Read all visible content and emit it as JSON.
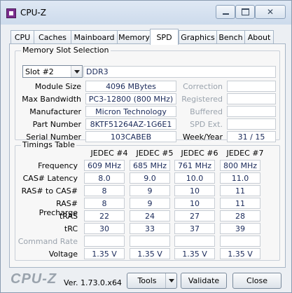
{
  "window": {
    "title": "CPU-Z"
  },
  "tabs": [
    "CPU",
    "Caches",
    "Mainboard",
    "Memory",
    "SPD",
    "Graphics",
    "Bench",
    "About"
  ],
  "active_tab": "SPD",
  "memory_slot": {
    "group_title": "Memory Slot Selection",
    "slot": "Slot #2",
    "type": "DDR3",
    "labels": {
      "module_size": "Module Size",
      "max_bandwidth": "Max Bandwidth",
      "manufacturer": "Manufacturer",
      "part_number": "Part Number",
      "serial_number": "Serial Number",
      "correction": "Correction",
      "registered": "Registered",
      "buffered": "Buffered",
      "spd_ext": "SPD Ext.",
      "week_year": "Week/Year"
    },
    "values": {
      "module_size": "4096 MBytes",
      "max_bandwidth": "PC3-12800 (800 MHz)",
      "manufacturer": "Micron Technology",
      "part_number": "8KTF51264AZ-1G6E1",
      "serial_number": "103CABEB",
      "correction": "",
      "registered": "",
      "buffered": "",
      "spd_ext": "",
      "week_year": "31 / 15"
    }
  },
  "timings": {
    "group_title": "Timings Table",
    "columns": [
      "JEDEC #4",
      "JEDEC #5",
      "JEDEC #6",
      "JEDEC #7"
    ],
    "rows": [
      {
        "label": "Frequency",
        "values": [
          "609 MHz",
          "685 MHz",
          "761 MHz",
          "800 MHz"
        ]
      },
      {
        "label": "CAS# Latency",
        "values": [
          "8.0",
          "9.0",
          "10.0",
          "11.0"
        ]
      },
      {
        "label": "RAS# to CAS#",
        "values": [
          "8",
          "9",
          "10",
          "11"
        ]
      },
      {
        "label": "RAS# Precharge",
        "values": [
          "8",
          "9",
          "10",
          "11"
        ]
      },
      {
        "label": "tRAS",
        "values": [
          "22",
          "24",
          "27",
          "28"
        ]
      },
      {
        "label": "tRC",
        "values": [
          "30",
          "33",
          "37",
          "39"
        ]
      },
      {
        "label": "Command Rate",
        "values": [
          "",
          "",
          "",
          ""
        ]
      },
      {
        "label": "Voltage",
        "values": [
          "1.35 V",
          "1.35 V",
          "1.35 V",
          "1.35 V"
        ]
      }
    ]
  },
  "footer": {
    "brand": "CPU-Z",
    "version": "Ver. 1.73.0.x64",
    "tools_label": "Tools",
    "validate_label": "Validate",
    "close_label": "Close"
  }
}
